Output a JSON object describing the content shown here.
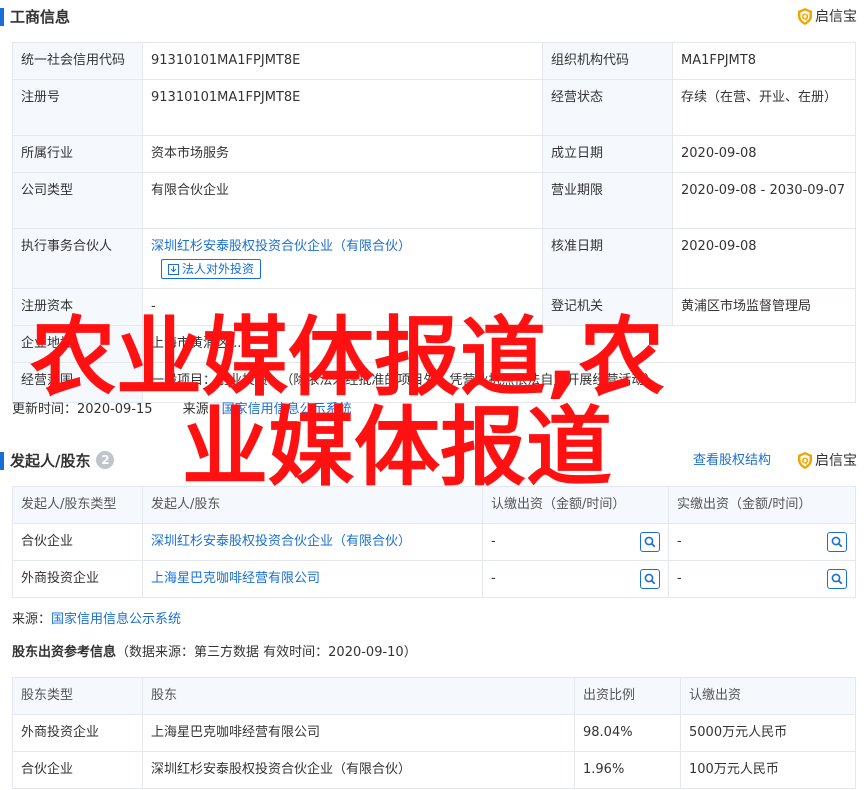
{
  "business_info": {
    "title": "工商信息",
    "brand": "启信宝",
    "rows": [
      {
        "l1": "统一社会信用代码",
        "v1": "91310101MA1FPJMT8E",
        "l2": "组织机构代码",
        "v2": "MA1FPJMT8"
      },
      {
        "l1": "注册号",
        "v1": "91310101MA1FPJMT8E",
        "l2": "经营状态",
        "v2": "存续（在营、开业、在册）"
      },
      {
        "l1": "所属行业",
        "v1": "资本市场服务",
        "l2": "成立日期",
        "v2": "2020-09-08"
      },
      {
        "l1": "公司类型",
        "v1": "有限合伙企业",
        "l2": "营业期限",
        "v2": "2020-09-08 - 2030-09-07"
      },
      {
        "l1": "执行事务合伙人",
        "v1": "深圳红杉安泰股权投资合伙企业（有限合伙）",
        "l2": "核准日期",
        "v2": "2020-09-08"
      },
      {
        "l1": "注册资本",
        "v1": "-",
        "l2": "登记机关",
        "v2": "黄浦区市场监督管理局"
      },
      {
        "l1": "企业地址",
        "v1": "上海市黄浦区..."
      },
      {
        "l1": "经营范围",
        "v1": "一般项目：创业投资...（除依法须经批准的项目外，凭营业执照依法自主开展经营活动）"
      }
    ],
    "invest_button": "法人对外投资",
    "updated_label": "更新时间：",
    "updated_value": "2020-09-15",
    "source_label": "来源：",
    "source_value": "国家信用信息公示系统"
  },
  "shareholders": {
    "title": "发起人/股东",
    "count": "2",
    "equity_link": "查看股权结构",
    "brand": "启信宝",
    "headers": [
      "发起人/股东类型",
      "发起人/股东",
      "认缴出资（金额/时间）",
      "实缴出资（金额/时间）"
    ],
    "rows": [
      {
        "type": "合伙企业",
        "name": "深圳红杉安泰股权投资合伙企业（有限合伙）",
        "subscribed": "-",
        "paid": "-"
      },
      {
        "type": "外商投资企业",
        "name": "上海星巴克咖啡经营有限公司",
        "subscribed": "-",
        "paid": "-"
      }
    ],
    "source_label": "来源：",
    "source_value": "国家信用信息公示系统"
  },
  "reference": {
    "title": "股东出资参考信息",
    "note": "（数据来源：第三方数据 有效时间：2020-09-10）",
    "headers": [
      "股东类型",
      "股东",
      "出资比例",
      "认缴出资"
    ],
    "rows": [
      {
        "type": "外商投资企业",
        "name": "上海星巴克咖啡经营有限公司",
        "ratio": "98.04%",
        "amount": "5000万元人民币"
      },
      {
        "type": "合伙企业",
        "name": "深圳红杉安泰股权投资合伙企业（有限合伙）",
        "ratio": "1.96%",
        "amount": "100万元人民币"
      }
    ]
  },
  "overlay": {
    "line1": "农业媒体报道,农",
    "line2": "业媒体报道"
  },
  "colors": {
    "accent": "#1a6fd6",
    "overlay": "#ff1111",
    "label_bg": "#f5f8fc",
    "border": "#e4e8ee"
  }
}
